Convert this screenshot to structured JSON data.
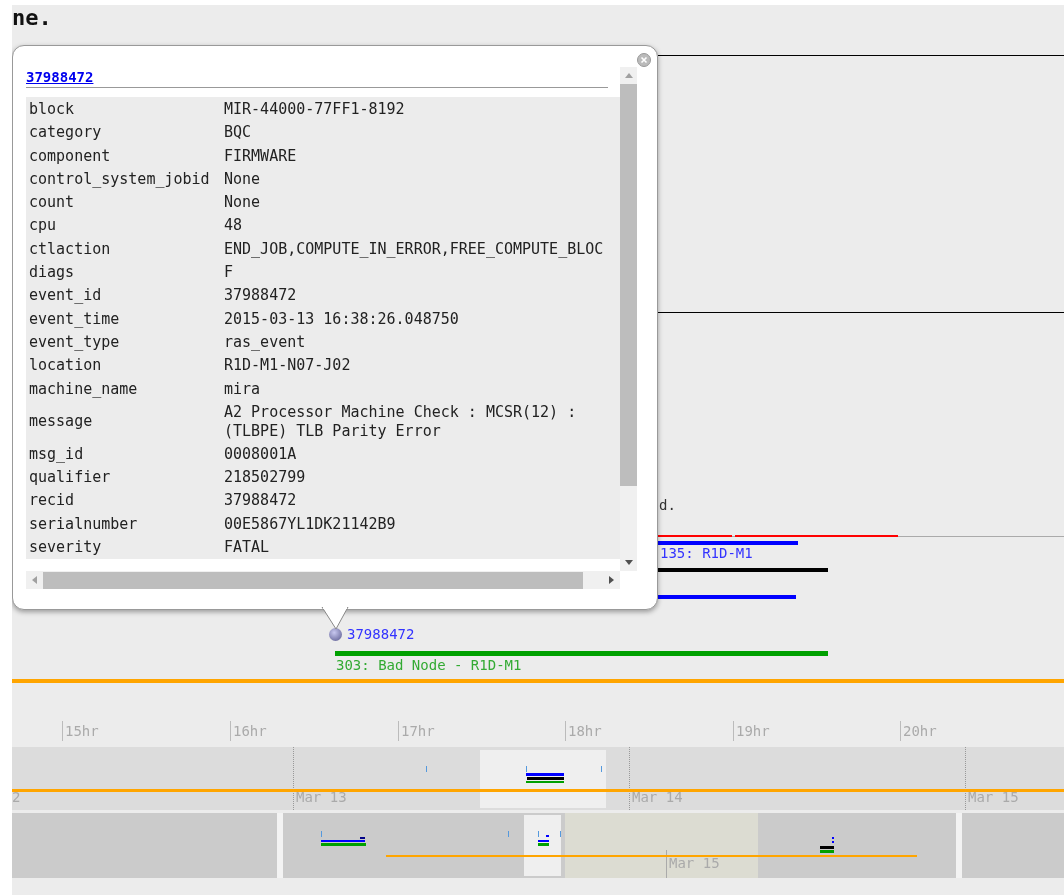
{
  "page_heading": "ne.",
  "timeline": {
    "bars": [
      {
        "color": "#ff0000"
      },
      {
        "color": "#ff0000"
      },
      {
        "color": "#0000ff"
      },
      {
        "color": "#000000"
      },
      {
        "color": "#0000ff"
      },
      {
        "color": "#00a000"
      },
      {
        "color": "#ffa500"
      }
    ],
    "labels": [
      {
        "text": "d.",
        "color": "#333333"
      },
      {
        "text": "135: R1D-M1",
        "color": "#3333ff"
      },
      {
        "text": "37988472",
        "color": "#3333ff"
      },
      {
        "text": "303: Bad Node - R1D-M1",
        "color": "#33aa33"
      }
    ],
    "hour_labels": [
      "15hr",
      "16hr",
      "17hr",
      "18hr",
      "19hr",
      "20hr"
    ],
    "day_labels": [
      "2",
      "Mar 13",
      "Mar 14",
      "Mar 15"
    ],
    "month_labels": [
      "Mar 15"
    ]
  },
  "popup": {
    "title": "37988472",
    "fields": [
      {
        "key": "block",
        "value": "MIR-44000-77FF1-8192"
      },
      {
        "key": "category",
        "value": "BQC"
      },
      {
        "key": "component",
        "value": "FIRMWARE"
      },
      {
        "key": "control_system_jobid",
        "value": "None"
      },
      {
        "key": "count",
        "value": "None"
      },
      {
        "key": "cpu",
        "value": "48"
      },
      {
        "key": "ctlaction",
        "value": "END_JOB,COMPUTE_IN_ERROR,FREE_COMPUTE_BLOC"
      },
      {
        "key": "diags",
        "value": "F"
      },
      {
        "key": "event_id",
        "value": "37988472"
      },
      {
        "key": "event_time",
        "value": "2015-03-13 16:38:26.048750"
      },
      {
        "key": "event_type",
        "value": "ras_event"
      },
      {
        "key": "location",
        "value": "R1D-M1-N07-J02"
      },
      {
        "key": "machine_name",
        "value": "mira"
      },
      {
        "key": "message",
        "value": "A2 Processor Machine Check : MCSR(12) : (TLBPE) TLB Parity Error"
      },
      {
        "key": "msg_id",
        "value": "0008001A"
      },
      {
        "key": "qualifier",
        "value": "218502799"
      },
      {
        "key": "recid",
        "value": "37988472"
      },
      {
        "key": "serialnumber",
        "value": "00E5867YL1DK21142B9"
      },
      {
        "key": "severity",
        "value": "FATAL"
      }
    ]
  }
}
